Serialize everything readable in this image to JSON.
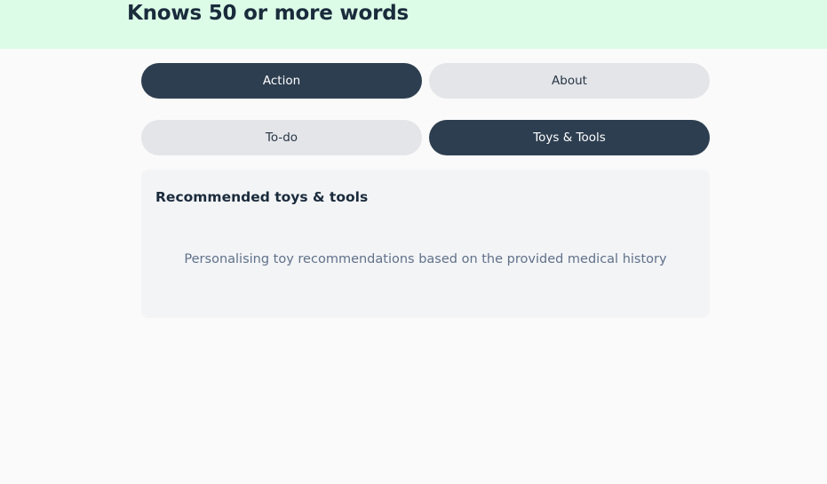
{
  "header": {
    "title": "Knows 50 or more words"
  },
  "tabs": [
    {
      "label": "Action",
      "active": true
    },
    {
      "label": "About",
      "active": false
    },
    {
      "label": "To-do",
      "active": false
    },
    {
      "label": "Toys & Tools",
      "active": true
    }
  ],
  "recommendations": {
    "title": "Recommended toys & tools",
    "status_message": "Personalising toy recommendations based on the provided medical history"
  },
  "colors": {
    "header_background": "#dcfce7",
    "active_tab": "#2d3e50",
    "inactive_tab": "#e4e5e9",
    "card_background": "#f3f4f6",
    "status_text": "#60718a"
  }
}
